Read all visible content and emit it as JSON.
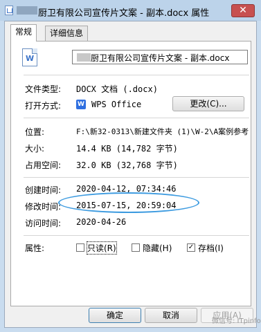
{
  "window": {
    "title": "厨卫有限公司宣传片文案 - 副本.docx 属性",
    "close_glyph": "✕"
  },
  "tabs": [
    {
      "label": "常规"
    },
    {
      "label": "详细信息"
    }
  ],
  "file": {
    "name": "厨卫有限公司宣传片文案 - 副本.docx",
    "icon_glyph": "W"
  },
  "fields": {
    "type_label": "文件类型:",
    "type_value": "DOCX 文档 (.docx)",
    "open_label": "打开方式:",
    "open_value": "WPS Office",
    "open_icon_glyph": "W",
    "change_button": "更改(C)...",
    "location_label": "位置:",
    "location_value": "F:\\新32-0313\\新建文件夹 (1)\\W-2\\A案例参考",
    "size_label": "大小:",
    "size_value": "14.4 KB (14,782 字节)",
    "disk_label": "占用空间:",
    "disk_value": "32.0 KB (32,768 字节)",
    "created_label": "创建时间:",
    "created_value": "2020-04-12, 07:34:46",
    "modified_label": "修改时间:",
    "modified_value": "2015-07-15, 20:59:04",
    "accessed_label": "访问时间:",
    "accessed_value": "2020-04-26"
  },
  "attributes": {
    "label": "属性:",
    "readonly": {
      "label": "只读(R)",
      "checked": false
    },
    "hidden": {
      "label": "隐藏(H)",
      "checked": false
    },
    "archive": {
      "label": "存档(I)",
      "checked": true
    }
  },
  "buttons": {
    "ok": "确定",
    "cancel": "取消",
    "apply": "应用(A)"
  },
  "watermark": "微信号: ITpinfo",
  "colors": {
    "highlight_ellipse": "#3d9be0",
    "title_bar": "#bcd3ea",
    "close_button": "#c75050"
  }
}
